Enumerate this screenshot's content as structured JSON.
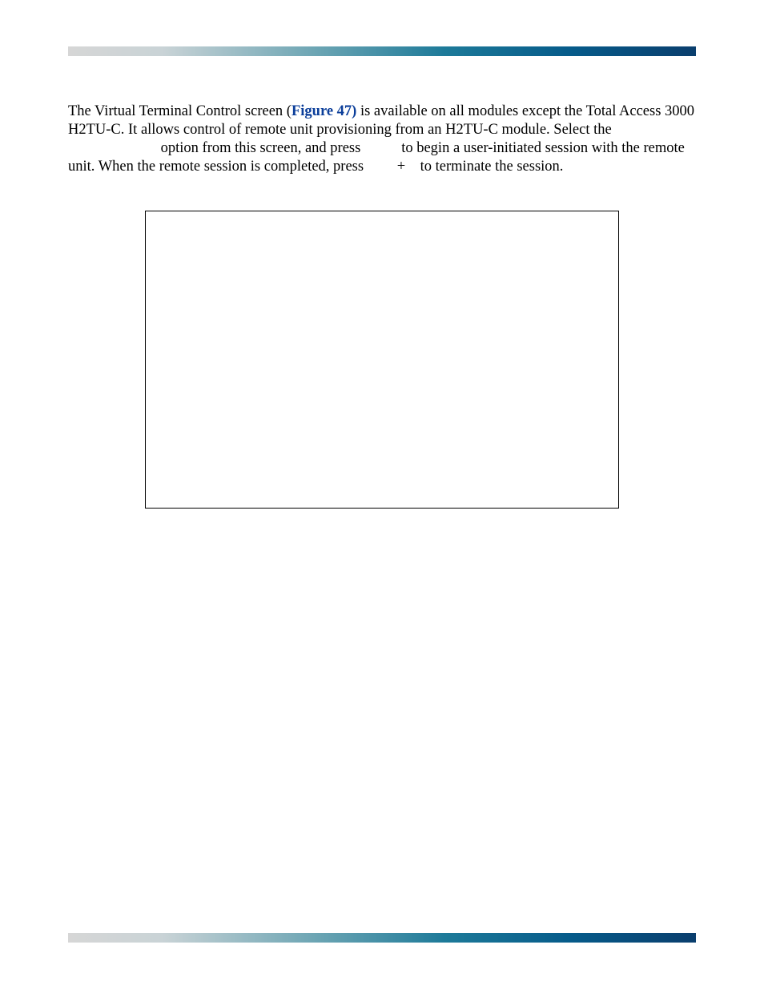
{
  "para": {
    "p1a": "The Virtual Terminal Control screen (",
    "link": "Figure 47)",
    "p1b": " is available on all modules except the Total Access 3000 H2TU-C. It allows control of remote unit provisioning from an H2TU-C module. Select the ",
    "gap1": "                        ",
    "p1c": " option from this screen, and press ",
    "gap2": "         ",
    "p1d": " to begin a user-initiated session with the remote unit. When the remote session is completed, press ",
    "gap3": "       ",
    "p1e": " + ",
    "gap4": "  ",
    "p1f": " to terminate the session."
  }
}
